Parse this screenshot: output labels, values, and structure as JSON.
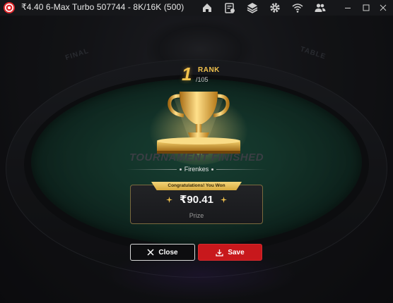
{
  "window": {
    "title": "₹4.40 6-Max Turbo 507744 - 8K/16K (500)",
    "toolbar_icons": [
      "lobby-home-icon",
      "cashier-icon",
      "stack-tables-icon",
      "settings-gear-icon",
      "wifi-signal-icon",
      "players-icon"
    ],
    "controls": [
      "minimize-icon",
      "maximize-icon",
      "close-icon"
    ]
  },
  "table": {
    "seat_labels": [
      "FINAL",
      "TABLE"
    ],
    "felt_color": "#1f5a45"
  },
  "result": {
    "rank_number": "1",
    "rank_word": "RANK",
    "rank_total": "/105",
    "finished_text": "TOURNAMENT FINISHED",
    "player_name": "Firenkes",
    "ribbon_text": "Congratulations! You Won",
    "prize_amount": "₹90.41",
    "prize_label": "Prize"
  },
  "buttons": {
    "close_label": "Close",
    "save_label": "Save"
  },
  "colors": {
    "gold": "#f2c24d",
    "save_red": "#c8181c"
  }
}
